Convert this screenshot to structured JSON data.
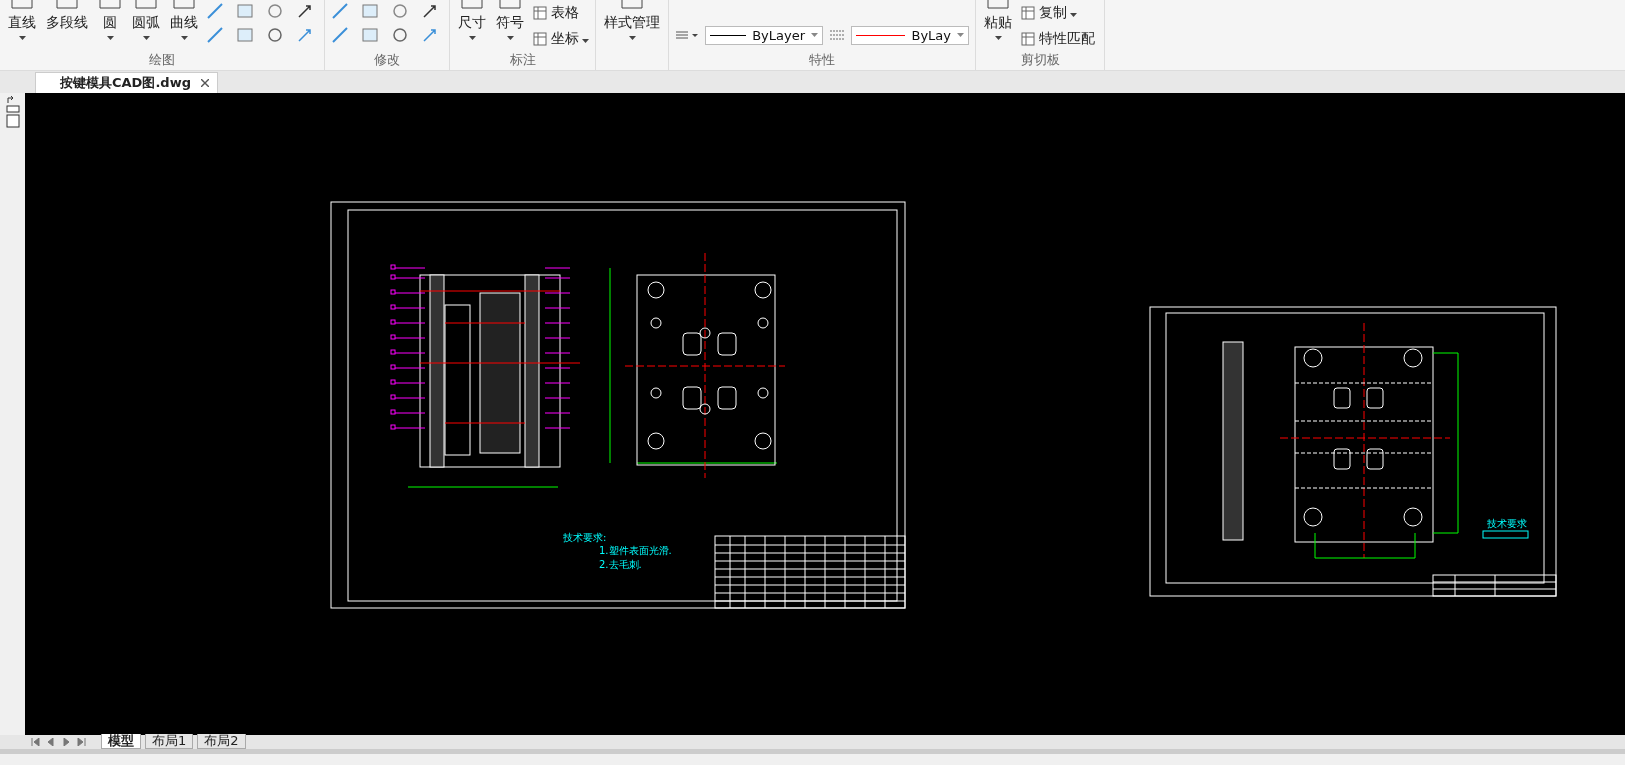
{
  "ribbon": {
    "groups": [
      {
        "kind": "draw",
        "title": "绘图",
        "buttons": [
          {
            "label": "直线",
            "caret": true
          },
          {
            "label": "多段线",
            "caret": false
          },
          {
            "label": "圆",
            "caret": true
          },
          {
            "label": "圆弧",
            "caret": true
          },
          {
            "label": "曲线",
            "caret": true
          }
        ]
      },
      {
        "kind": "modify",
        "title": "修改"
      },
      {
        "kind": "annotate",
        "title": "标注",
        "buttons": [
          {
            "label": "尺寸",
            "caret": true
          },
          {
            "label": "符号",
            "caret": true
          }
        ],
        "small_buttons": [
          {
            "label": "表格",
            "caret": false
          },
          {
            "label": "坐标",
            "caret": true
          }
        ]
      },
      {
        "kind": "style",
        "buttons": [
          {
            "label": "样式管理",
            "caret": true
          }
        ]
      },
      {
        "kind": "properties",
        "title": "特性",
        "dropdowns": [
          {
            "value": "ByLayer",
            "color": "#000000"
          },
          {
            "value": "ByLay",
            "color": "#ff0000"
          }
        ]
      },
      {
        "kind": "clipboard",
        "title": "剪切板",
        "buttons": [
          {
            "label": "粘贴",
            "caret": true
          }
        ],
        "small_buttons": [
          {
            "label": "复制",
            "caret": true
          },
          {
            "label": "特性匹配",
            "caret": false
          }
        ]
      }
    ]
  },
  "document_tab": {
    "title": "按键模具CAD图.dwg"
  },
  "canvas": {
    "notes": [
      "技术要求:",
      "1.塑件表面光滑.",
      "2.去毛刺."
    ],
    "right_label": "技术要求"
  },
  "layout_tabs": [
    {
      "label": "模型",
      "selected": true
    },
    {
      "label": "布局1",
      "selected": false
    },
    {
      "label": "布局2",
      "selected": false
    }
  ]
}
